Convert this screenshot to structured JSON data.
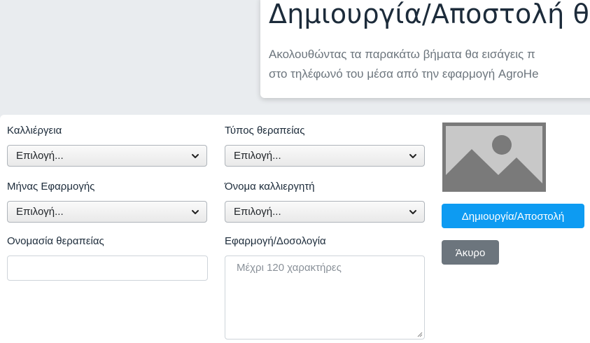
{
  "header": {
    "title": "Δημιουργία/Αποστολή θ",
    "desc_line1": "Ακολουθώντας τα παρακάτω βήματα θα εισάγεις π",
    "desc_line2": "στο τηλέφωνό του μέσα από την εφαρμογή AgroHe"
  },
  "form": {
    "crop": {
      "label": "Καλλιέργεια",
      "value": "Επιλογή..."
    },
    "treatment_type": {
      "label": "Τύπος θεραπείας",
      "value": "Επιλογή..."
    },
    "month": {
      "label": "Μήνας Εφαρμογής",
      "value": "Επιλογή..."
    },
    "grower": {
      "label": "Όνομα καλλιεργητή",
      "value": "Επιλογή..."
    },
    "treatment_name": {
      "label": "Ονομασία θεραπείας",
      "value": ""
    },
    "application": {
      "label": "Εφαρμογή/Δοσολογία",
      "placeholder": "Μέχρι 120 χαρακτήρες",
      "value": ""
    }
  },
  "actions": {
    "submit_label": "Δημιουργία/Αποστολή",
    "cancel_label": "Άκυρο"
  },
  "colors": {
    "primary": "#0d9bf2",
    "secondary": "#6c757d",
    "background": "#e9ecef"
  }
}
